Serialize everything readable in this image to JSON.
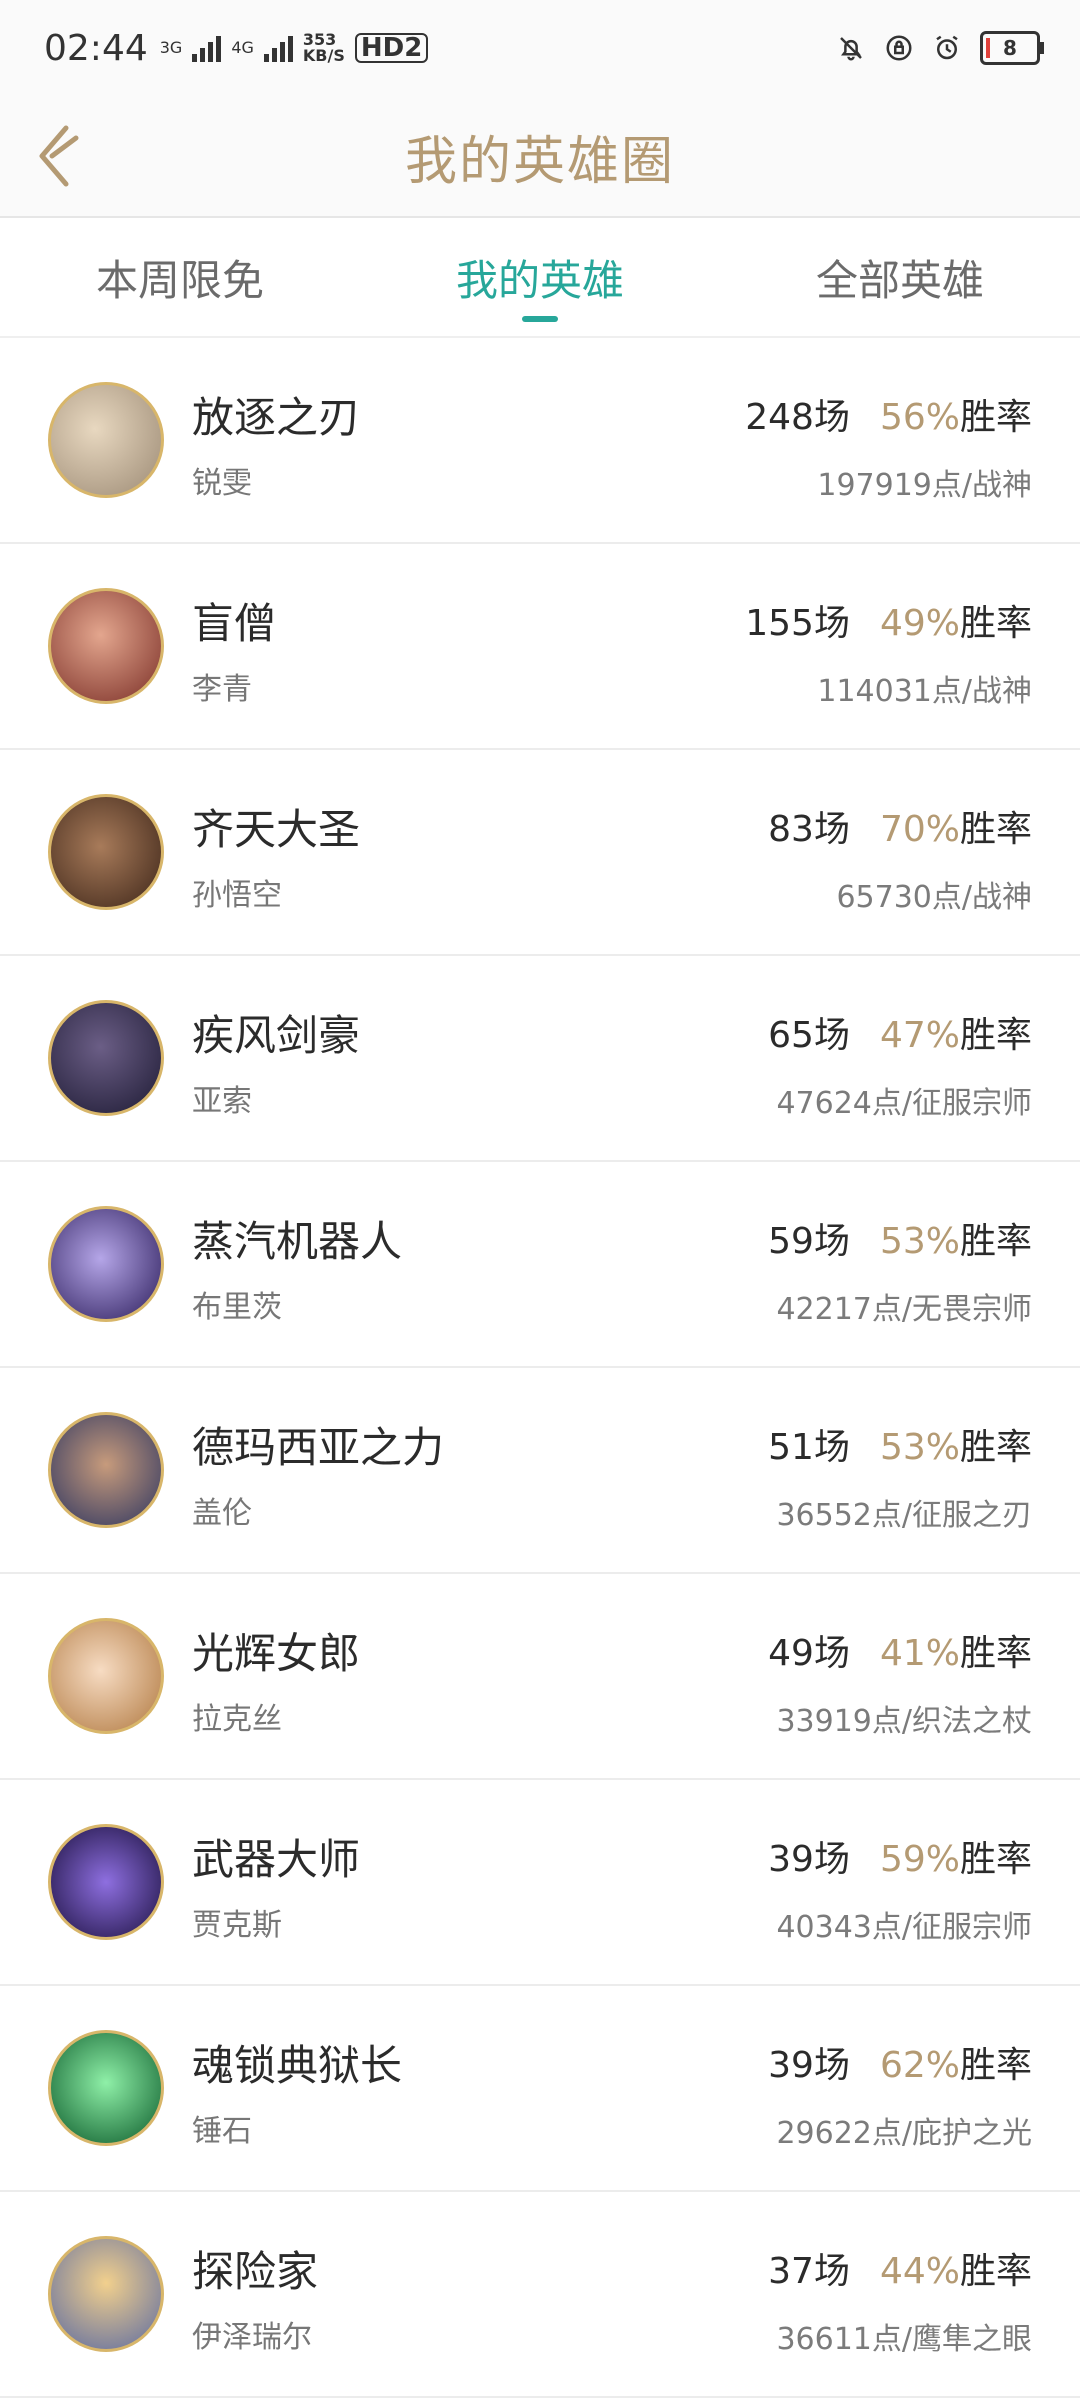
{
  "status": {
    "time": "02:44",
    "net1": "3G",
    "net2": "4G",
    "speed_top": "353",
    "speed_bottom": "KB/S",
    "hd": "HD2",
    "battery": "8"
  },
  "header": {
    "title": "我的英雄圈",
    "back_icon": "chevron-left-icon"
  },
  "tabs": [
    {
      "label": "本周限免",
      "active": false
    },
    {
      "label": "我的英雄",
      "active": true
    },
    {
      "label": "全部英雄",
      "active": false
    }
  ],
  "colors": {
    "accent": "#27a79a",
    "gold": "#b49a73"
  },
  "heroes": [
    {
      "title": "放逐之刃",
      "name": "锐雯",
      "games": "248场",
      "win": "56%",
      "win_label": "胜率",
      "score": "197919点/战神",
      "avatar_color": "#c9b08d"
    },
    {
      "title": "盲僧",
      "name": "李青",
      "games": "155场",
      "win": "49%",
      "win_label": "胜率",
      "score": "114031点/战神",
      "avatar_color": "#b55a4f"
    },
    {
      "title": "齐天大圣",
      "name": "孙悟空",
      "games": "83场",
      "win": "70%",
      "win_label": "胜率",
      "score": "65730点/战神",
      "avatar_color": "#5a3b2b"
    },
    {
      "title": "疾风剑豪",
      "name": "亚索",
      "games": "65场",
      "win": "47%",
      "win_label": "胜率",
      "score": "47624点/征服宗师",
      "avatar_color": "#2e2c54"
    },
    {
      "title": "蒸汽机器人",
      "name": "布里茨",
      "games": "59场",
      "win": "53%",
      "win_label": "胜率",
      "score": "42217点/无畏宗师",
      "avatar_color": "#3f2d77"
    },
    {
      "title": "德玛西亚之力",
      "name": "盖伦",
      "games": "51场",
      "win": "53%",
      "win_label": "胜率",
      "score": "36552点/征服之刃",
      "avatar_color": "#4b4a72"
    },
    {
      "title": "光辉女郎",
      "name": "拉克丝",
      "games": "49场",
      "win": "41%",
      "win_label": "胜率",
      "score": "33919点/织法之杖",
      "avatar_color": "#e2b98d"
    },
    {
      "title": "武器大师",
      "name": "贾克斯",
      "games": "39场",
      "win": "59%",
      "win_label": "胜率",
      "score": "40343点/征服宗师",
      "avatar_color": "#5b3fa0"
    },
    {
      "title": "魂锁典狱长",
      "name": "锤石",
      "games": "39场",
      "win": "62%",
      "win_label": "胜率",
      "score": "29622点/庇护之光",
      "avatar_color": "#1aa34d"
    },
    {
      "title": "探险家",
      "name": "伊泽瑞尔",
      "games": "37场",
      "win": "44%",
      "win_label": "胜率",
      "score": "36611点/鹰隼之眼",
      "avatar_color": "#c99f58"
    }
  ]
}
